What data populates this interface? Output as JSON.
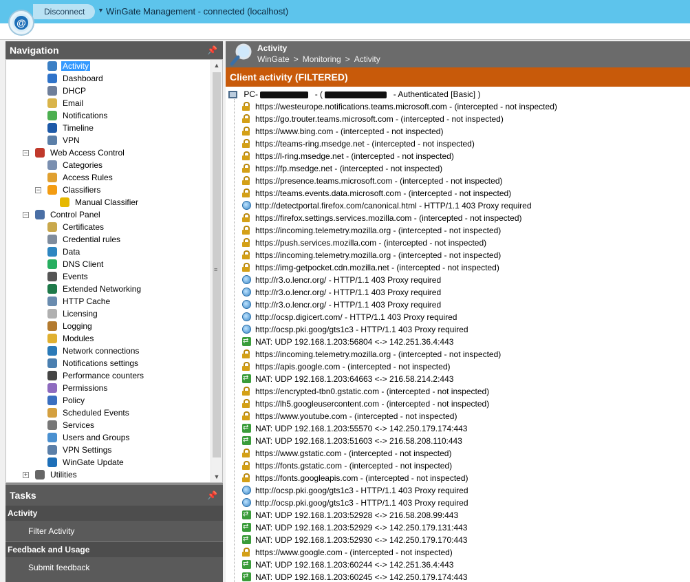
{
  "window": {
    "disconnect_label": "Disconnect",
    "title": "WinGate Management - connected (localhost)"
  },
  "navigation": {
    "header": "Navigation",
    "items": [
      {
        "label": "Activity",
        "icon": "magnifier-icon",
        "color": "#3b7fc4"
      },
      {
        "label": "Dashboard",
        "icon": "dashboard-icon",
        "color": "#2f73c9"
      },
      {
        "label": "DHCP",
        "icon": "dhcp-icon",
        "color": "#6f7f9a"
      },
      {
        "label": "Email",
        "icon": "email-icon",
        "color": "#d9b44a"
      },
      {
        "label": "Notifications",
        "icon": "notifications-icon",
        "color": "#4caf50"
      },
      {
        "label": "Timeline",
        "icon": "timeline-icon",
        "color": "#1e5aa8"
      },
      {
        "label": "VPN",
        "icon": "vpn-icon",
        "color": "#5b7fa8"
      },
      {
        "label": "Web Access Control",
        "icon": "web-access-icon",
        "color": "#c0392b"
      },
      {
        "label": "Categories",
        "icon": "categories-icon",
        "color": "#7a8fb0"
      },
      {
        "label": "Access Rules",
        "icon": "access-rules-icon",
        "color": "#e0a030"
      },
      {
        "label": "Classifiers",
        "icon": "classifiers-icon",
        "color": "#f39c12"
      },
      {
        "label": "Manual Classifier",
        "icon": "manual-classifier-icon",
        "color": "#e6b800"
      },
      {
        "label": "Control Panel",
        "icon": "control-panel-icon",
        "color": "#4a6fa5"
      },
      {
        "label": "Certificates",
        "icon": "certificates-icon",
        "color": "#c9a84c"
      },
      {
        "label": "Credential rules",
        "icon": "credential-rules-icon",
        "color": "#7f8c9d"
      },
      {
        "label": "Data",
        "icon": "data-icon",
        "color": "#2e86c1"
      },
      {
        "label": "DNS Client",
        "icon": "dns-client-icon",
        "color": "#27ae60"
      },
      {
        "label": "Events",
        "icon": "events-icon",
        "color": "#555555"
      },
      {
        "label": "Extended Networking",
        "icon": "extended-networking-icon",
        "color": "#1f7a4a"
      },
      {
        "label": "HTTP Cache",
        "icon": "http-cache-icon",
        "color": "#6a8caf"
      },
      {
        "label": "Licensing",
        "icon": "licensing-icon",
        "color": "#b0b0b0"
      },
      {
        "label": "Logging",
        "icon": "logging-icon",
        "color": "#b37a2e"
      },
      {
        "label": "Modules",
        "icon": "modules-icon",
        "color": "#e0b030"
      },
      {
        "label": "Network connections",
        "icon": "network-connections-icon",
        "color": "#2a7ab8"
      },
      {
        "label": "Notifications settings",
        "icon": "notifications-settings-icon",
        "color": "#4a7fb0"
      },
      {
        "label": "Performance counters",
        "icon": "performance-counters-icon",
        "color": "#444444"
      },
      {
        "label": "Permissions",
        "icon": "permissions-icon",
        "color": "#8e6bbf"
      },
      {
        "label": "Policy",
        "icon": "policy-icon",
        "color": "#3a6fc0"
      },
      {
        "label": "Scheduled Events",
        "icon": "scheduled-events-icon",
        "color": "#d4a040"
      },
      {
        "label": "Services",
        "icon": "services-icon",
        "color": "#777777"
      },
      {
        "label": "Users and Groups",
        "icon": "users-groups-icon",
        "color": "#4a90d0"
      },
      {
        "label": "VPN Settings",
        "icon": "vpn-settings-icon",
        "color": "#5b7fa8"
      },
      {
        "label": "WinGate Update",
        "icon": "wingate-update-icon",
        "color": "#1d6fb8"
      },
      {
        "label": "Utilities",
        "icon": "utilities-icon",
        "color": "#666666"
      }
    ]
  },
  "tasks": {
    "header": "Tasks",
    "sections": [
      {
        "title": "Activity",
        "link": "Filter Activity"
      },
      {
        "title": "Feedback and Usage",
        "link": "Submit feedback"
      }
    ]
  },
  "content": {
    "title": "Activity",
    "breadcrumb": [
      "WinGate",
      "Monitoring",
      "Activity"
    ],
    "section_title": "Client activity (FILTERED)",
    "client": {
      "prefix": "PC-",
      "separator_open": "- (",
      "status": "-  Authenticated [Basic] )"
    },
    "rows": [
      {
        "type": "lock",
        "text": "https://westeurope.notifications.teams.microsoft.com - (intercepted - not inspected)"
      },
      {
        "type": "lock",
        "text": "https://go.trouter.teams.microsoft.com - (intercepted - not inspected)"
      },
      {
        "type": "lock",
        "text": "https://www.bing.com - (intercepted - not inspected)"
      },
      {
        "type": "lock",
        "text": "https://teams-ring.msedge.net - (intercepted - not inspected)"
      },
      {
        "type": "lock",
        "text": "https://l-ring.msedge.net - (intercepted - not inspected)"
      },
      {
        "type": "lock",
        "text": "https://fp.msedge.net - (intercepted - not inspected)"
      },
      {
        "type": "lock",
        "text": "https://presence.teams.microsoft.com - (intercepted - not inspected)"
      },
      {
        "type": "lock",
        "text": "https://teams.events.data.microsoft.com - (intercepted - not inspected)"
      },
      {
        "type": "globe",
        "text": "http://detectportal.firefox.com/canonical.html - HTTP/1.1 403 Proxy required"
      },
      {
        "type": "lock",
        "text": "https://firefox.settings.services.mozilla.com - (intercepted - not inspected)"
      },
      {
        "type": "lock",
        "text": "https://incoming.telemetry.mozilla.org - (intercepted - not inspected)"
      },
      {
        "type": "lock",
        "text": "https://push.services.mozilla.com - (intercepted - not inspected)"
      },
      {
        "type": "lock",
        "text": "https://incoming.telemetry.mozilla.org - (intercepted - not inspected)"
      },
      {
        "type": "lock",
        "text": "https://img-getpocket.cdn.mozilla.net - (intercepted - not inspected)"
      },
      {
        "type": "globe",
        "text": "http://r3.o.lencr.org/ - HTTP/1.1 403 Proxy required"
      },
      {
        "type": "globe",
        "text": "http://r3.o.lencr.org/ - HTTP/1.1 403 Proxy required"
      },
      {
        "type": "globe",
        "text": "http://r3.o.lencr.org/ - HTTP/1.1 403 Proxy required"
      },
      {
        "type": "globe",
        "text": "http://ocsp.digicert.com/ - HTTP/1.1 403 Proxy required"
      },
      {
        "type": "globe",
        "text": "http://ocsp.pki.goog/gts1c3 - HTTP/1.1 403 Proxy required"
      },
      {
        "type": "nat",
        "text": "NAT: UDP 192.168.1.203:56804 <-> 142.251.36.4:443"
      },
      {
        "type": "lock",
        "text": "https://incoming.telemetry.mozilla.org - (intercepted - not inspected)"
      },
      {
        "type": "lock",
        "text": "https://apis.google.com - (intercepted - not inspected)"
      },
      {
        "type": "nat",
        "text": "NAT: UDP 192.168.1.203:64663 <-> 216.58.214.2:443"
      },
      {
        "type": "lock",
        "text": "https://encrypted-tbn0.gstatic.com - (intercepted - not inspected)"
      },
      {
        "type": "lock",
        "text": "https://lh5.googleusercontent.com - (intercepted - not inspected)"
      },
      {
        "type": "lock",
        "text": "https://www.youtube.com - (intercepted - not inspected)"
      },
      {
        "type": "nat",
        "text": "NAT: UDP 192.168.1.203:55570 <-> 142.250.179.174:443"
      },
      {
        "type": "nat",
        "text": "NAT: UDP 192.168.1.203:51603 <-> 216.58.208.110:443"
      },
      {
        "type": "lock",
        "text": "https://www.gstatic.com - (intercepted - not inspected)"
      },
      {
        "type": "lock",
        "text": "https://fonts.gstatic.com - (intercepted - not inspected)"
      },
      {
        "type": "lock",
        "text": "https://fonts.googleapis.com - (intercepted - not inspected)"
      },
      {
        "type": "globe",
        "text": "http://ocsp.pki.goog/gts1c3 - HTTP/1.1 403 Proxy required"
      },
      {
        "type": "globe",
        "text": "http://ocsp.pki.goog/gts1c3 - HTTP/1.1 403 Proxy required"
      },
      {
        "type": "nat",
        "text": "NAT: UDP 192.168.1.203:52928 <-> 216.58.208.99:443"
      },
      {
        "type": "nat",
        "text": "NAT: UDP 192.168.1.203:52929 <-> 142.250.179.131:443"
      },
      {
        "type": "nat",
        "text": "NAT: UDP 192.168.1.203:52930 <-> 142.250.179.170:443"
      },
      {
        "type": "lock",
        "text": "https://www.google.com - (intercepted - not inspected)"
      },
      {
        "type": "nat",
        "text": "NAT: UDP 192.168.1.203:60244 <-> 142.251.36.4:443"
      },
      {
        "type": "nat",
        "text": "NAT: UDP 192.168.1.203:60245 <-> 142.250.179.174:443"
      }
    ]
  }
}
